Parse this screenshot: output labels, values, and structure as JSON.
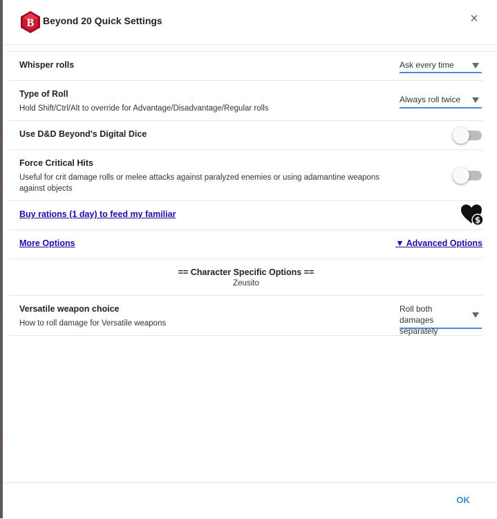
{
  "dialog": {
    "title": "Beyond 20 Quick Settings",
    "close_glyph": "×",
    "ok_label": "OK"
  },
  "options": {
    "whisper": {
      "title": "Whisper rolls",
      "value": "Ask every time"
    },
    "roll_type": {
      "title": "Type of Roll",
      "description": "Hold Shift/Ctrl/Alt to override for Advantage/Disadvantage/Regular rolls",
      "value": "Always roll twice"
    },
    "digital_dice": {
      "title": "Use D&D Beyond's Digital Dice",
      "enabled": false
    },
    "force_crit": {
      "title": "Force Critical Hits",
      "description": "Useful for crit damage rolls or melee attacks against paralyzed enemies or using adamantine weapons against objects",
      "enabled": false
    }
  },
  "links": {
    "donate": "Buy rations (1 day) to feed my familiar",
    "more_options": "More Options",
    "advanced_options": "▼ Advanced Options"
  },
  "character": {
    "section_title": "== Character Specific Options ==",
    "name": "Zeusito",
    "versatile": {
      "title": "Versatile weapon choice",
      "description": "How to roll damage for Versatile weapons",
      "value": "Roll both damages separately"
    }
  },
  "icons": {
    "logo": "beyond20-logo-icon",
    "donate": "heart-dollar-icon",
    "close": "close-icon"
  },
  "colors": {
    "logo_red": "#c8102e",
    "select_underline": "#4a86e8",
    "link": "#1a0dab",
    "ok": "#3b8fd0",
    "toggle_track": "#bdbdbd"
  }
}
